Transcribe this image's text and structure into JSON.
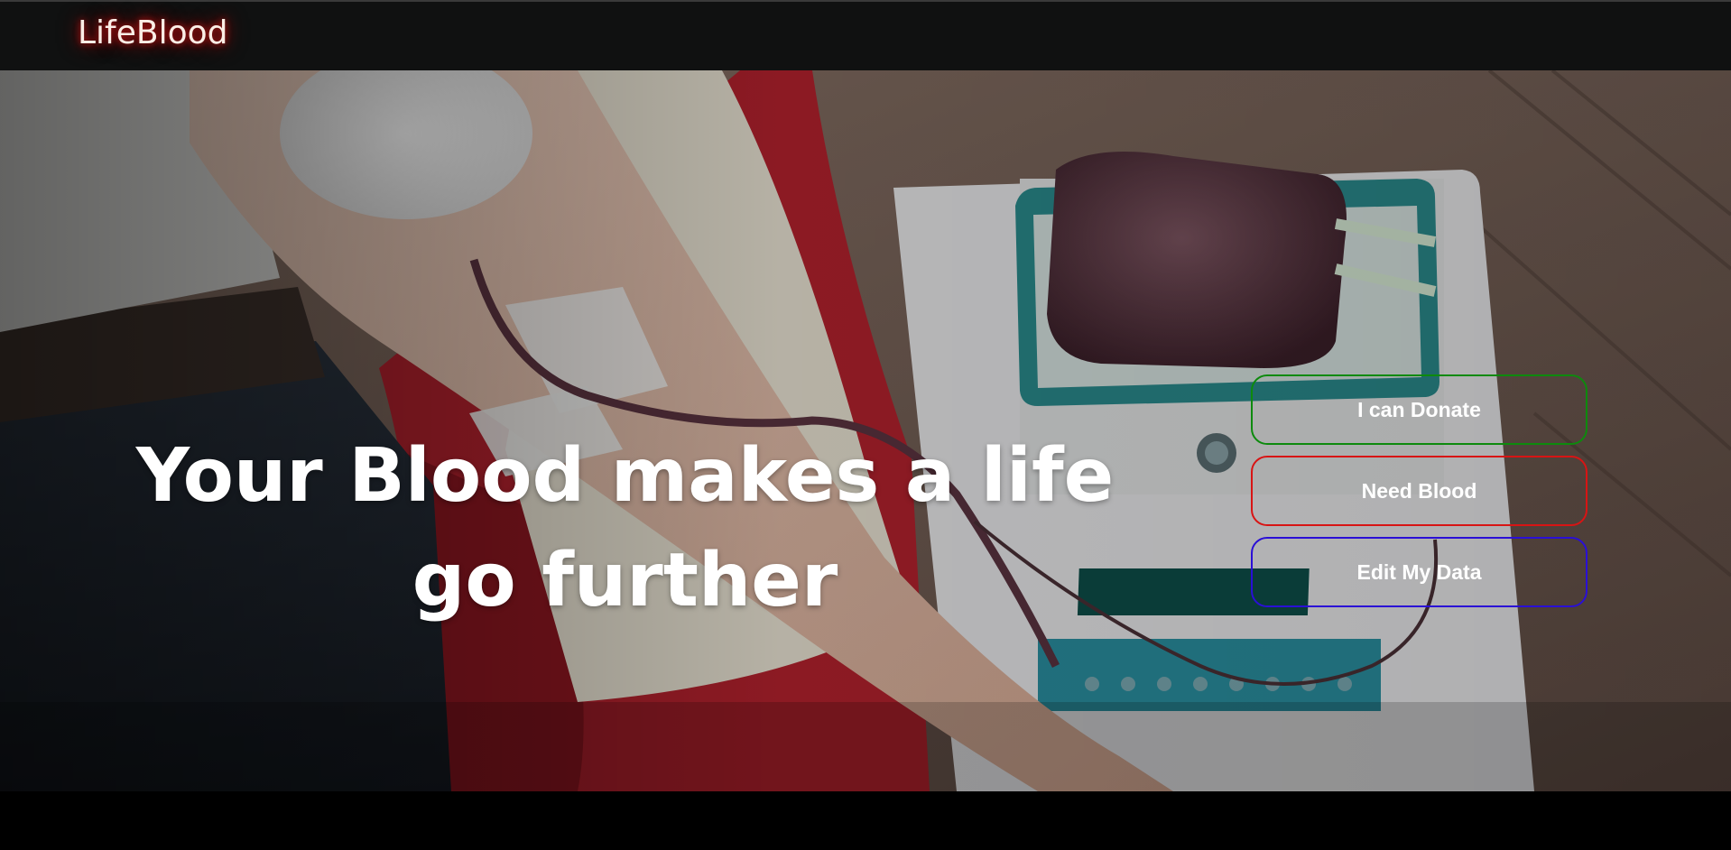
{
  "navbar": {
    "brand": "LifeBlood",
    "brand_glow_color": "#c51515",
    "background_color": "#101111"
  },
  "hero": {
    "headline": "Your Blood makes a life go further",
    "image_description_icon": "blood-donation-photo"
  },
  "actions": {
    "donate_label": "I can Donate",
    "donate_border_color": "#0d8a0d",
    "need_blood_label": "Need Blood",
    "need_blood_border_color": "#d81414",
    "edit_data_label": "Edit My Data",
    "edit_data_border_color": "#2a0fd6"
  }
}
